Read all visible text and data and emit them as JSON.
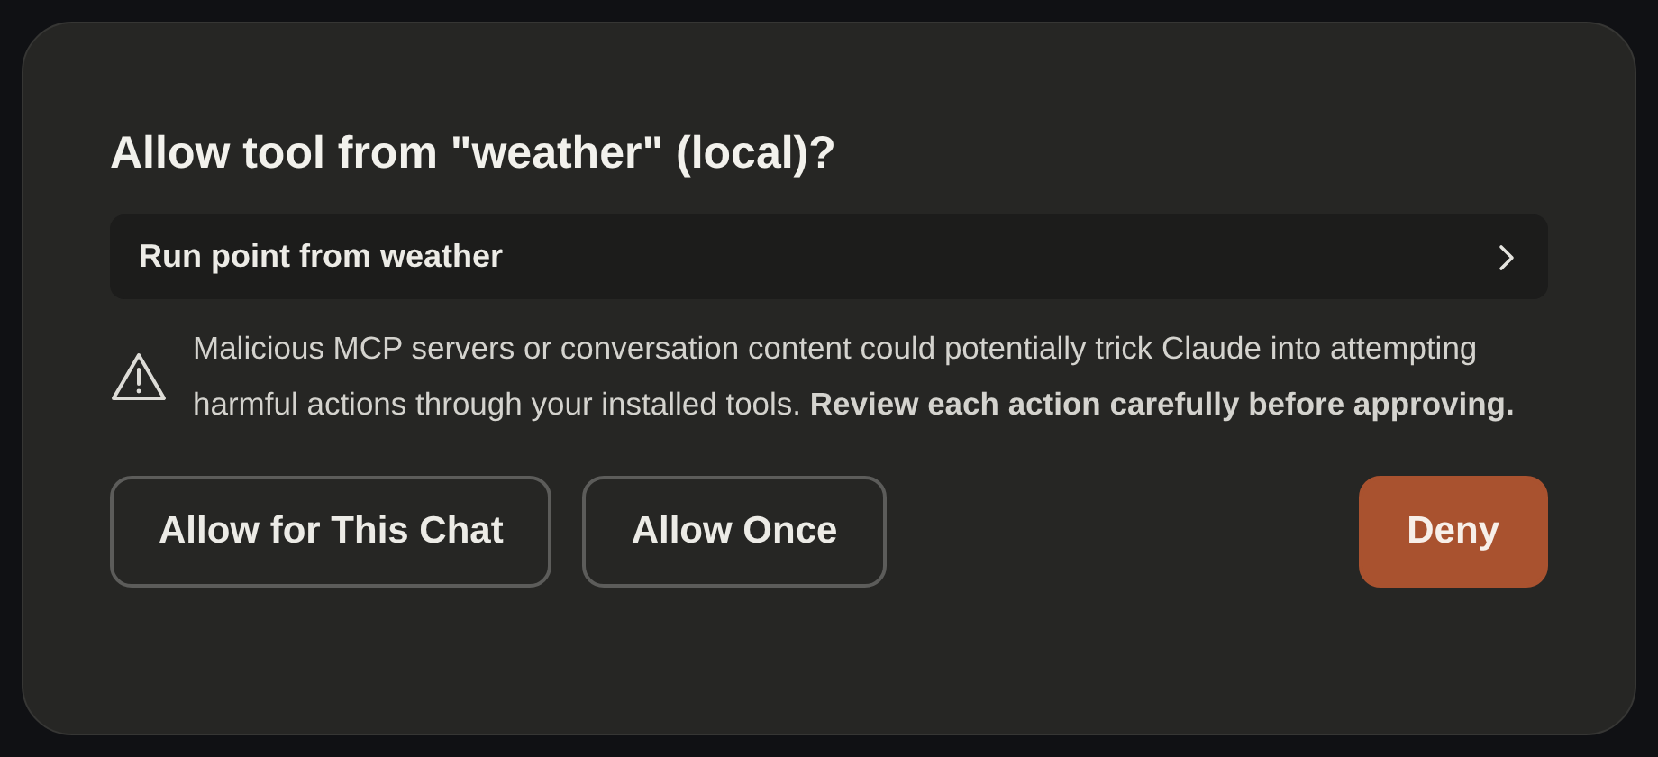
{
  "dialog": {
    "title": "Allow tool from \"weather\" (local)?",
    "tool_call": {
      "label": "Run point from weather",
      "expanded": false
    },
    "warning": "Malicious MCP servers or conversation content could potentially trick Claude into attempting harmful actions through your installed tools. **Review each action carefully before approving.**",
    "buttons": [
      {
        "label": "Allow for This Chat",
        "kind": "outline"
      },
      {
        "label": "Allow Once",
        "kind": "outline"
      },
      {
        "label": "Deny",
        "kind": "primary"
      }
    ]
  }
}
